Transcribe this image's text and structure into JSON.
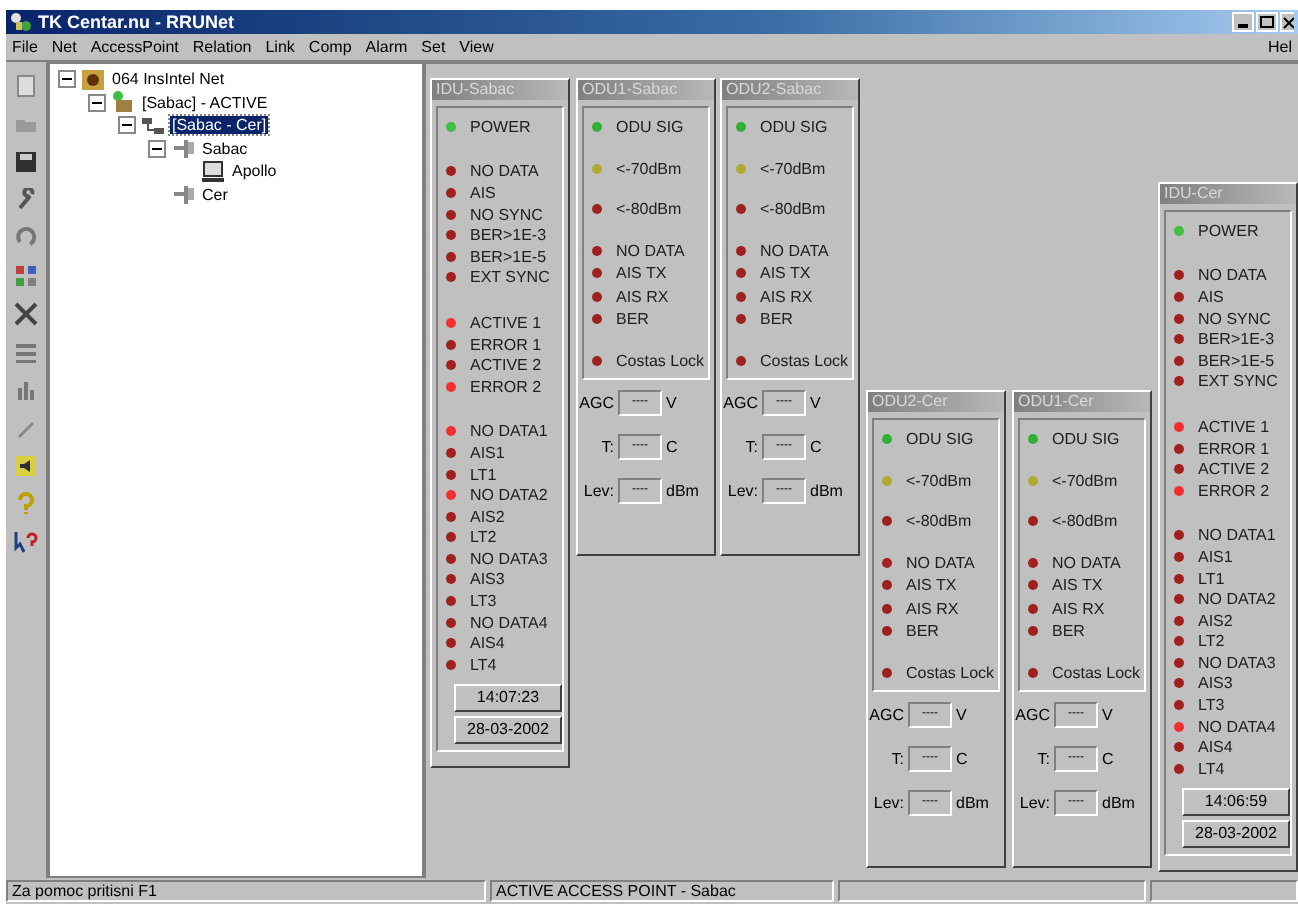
{
  "window": {
    "title": "TK Centar.nu - RRUNet"
  },
  "menu": [
    "File",
    "Net",
    "AccessPoint",
    "Relation",
    "Link",
    "Comp",
    "Alarm",
    "Set",
    "View"
  ],
  "help_menu": "Hel",
  "tree": [
    {
      "label": "064 InsIntel Net",
      "kind": "net",
      "selected": false,
      "expanded": true,
      "children": [
        {
          "label": "[Sabac] - ACTIVE",
          "kind": "access_point",
          "selected": false,
          "expanded": true,
          "children": [
            {
              "label": "[Sabac - Cer]",
              "kind": "relation",
              "selected": true,
              "expanded": true,
              "children": [
                {
                  "label": "Sabac",
                  "kind": "device",
                  "selected": false,
                  "expanded": true,
                  "children": [
                    {
                      "label": "Apollo",
                      "kind": "terminal",
                      "selected": false
                    }
                  ]
                },
                {
                  "label": "Cer",
                  "kind": "device",
                  "selected": false
                }
              ]
            }
          ]
        }
      ]
    }
  ],
  "panels": [
    {
      "kind": "idu",
      "title": "IDU-Sabac",
      "groups": [
        [
          {
            "label": "POWER",
            "color": "#40c040"
          }
        ],
        [
          {
            "label": "NO DATA",
            "color": "#a02020"
          },
          {
            "label": "AIS",
            "color": "#a02020"
          },
          {
            "label": "NO SYNC",
            "color": "#a02020"
          },
          {
            "label": "BER>1E-3",
            "color": "#a02020"
          },
          {
            "label": "BER>1E-5",
            "color": "#a02020"
          },
          {
            "label": "EXT SYNC",
            "color": "#a02020"
          }
        ],
        [
          {
            "label": "ACTIVE 1",
            "color": "#f03030"
          },
          {
            "label": "ERROR 1",
            "color": "#a02020"
          },
          {
            "label": "ACTIVE 2",
            "color": "#a02020"
          },
          {
            "label": "ERROR 2",
            "color": "#f03030"
          }
        ],
        [
          {
            "label": "NO DATA1",
            "color": "#f03030"
          },
          {
            "label": "AIS1",
            "color": "#a02020"
          },
          {
            "label": "LT1",
            "color": "#a02020"
          },
          {
            "label": "NO DATA2",
            "color": "#f03030"
          },
          {
            "label": "AIS2",
            "color": "#a02020"
          },
          {
            "label": "LT2",
            "color": "#a02020"
          },
          {
            "label": "NO DATA3",
            "color": "#a02020"
          },
          {
            "label": "AIS3",
            "color": "#a02020"
          },
          {
            "label": "LT3",
            "color": "#a02020"
          },
          {
            "label": "NO DATA4",
            "color": "#a02020"
          },
          {
            "label": "AIS4",
            "color": "#a02020"
          },
          {
            "label": "LT4",
            "color": "#a02020"
          }
        ]
      ],
      "time": "14:07:23",
      "date": "28-03-2002"
    },
    {
      "kind": "odu",
      "title": "ODU1-Sabac",
      "groups": [
        [
          {
            "label": "ODU SIG",
            "color": "#30b030"
          }
        ],
        [
          {
            "label": "<-70dBm",
            "color": "#b0a830"
          }
        ],
        [
          {
            "label": "<-80dBm",
            "color": "#a02020"
          }
        ],
        [
          {
            "label": "NO DATA",
            "color": "#a02020"
          },
          {
            "label": "AIS TX",
            "color": "#a02020"
          },
          {
            "label": "AIS RX",
            "color": "#a02020"
          },
          {
            "label": "BER",
            "color": "#a02020"
          }
        ],
        [
          {
            "label": "Costas Lock",
            "color": "#a02020"
          }
        ]
      ],
      "fields": [
        {
          "label": "AGC",
          "value": "----",
          "unit": "V"
        },
        {
          "label": "T:",
          "value": "----",
          "unit": "C"
        },
        {
          "label": "Lev:",
          "value": "----",
          "unit": "dBm"
        }
      ]
    },
    {
      "kind": "odu",
      "title": "ODU2-Sabac",
      "groups": [
        [
          {
            "label": "ODU SIG",
            "color": "#30b030"
          }
        ],
        [
          {
            "label": "<-70dBm",
            "color": "#b0a830"
          }
        ],
        [
          {
            "label": "<-80dBm",
            "color": "#a02020"
          }
        ],
        [
          {
            "label": "NO DATA",
            "color": "#a02020"
          },
          {
            "label": "AIS TX",
            "color": "#a02020"
          },
          {
            "label": "AIS RX",
            "color": "#a02020"
          },
          {
            "label": "BER",
            "color": "#a02020"
          }
        ],
        [
          {
            "label": "Costas Lock",
            "color": "#a02020"
          }
        ]
      ],
      "fields": [
        {
          "label": "AGC",
          "value": "----",
          "unit": "V"
        },
        {
          "label": "T:",
          "value": "----",
          "unit": "C"
        },
        {
          "label": "Lev:",
          "value": "----",
          "unit": "dBm"
        }
      ]
    },
    {
      "kind": "odu",
      "title": "ODU2-Cer",
      "groups": [
        [
          {
            "label": "ODU SIG",
            "color": "#30b030"
          }
        ],
        [
          {
            "label": "<-70dBm",
            "color": "#b0a830"
          }
        ],
        [
          {
            "label": "<-80dBm",
            "color": "#a02020"
          }
        ],
        [
          {
            "label": "NO DATA",
            "color": "#a02020"
          },
          {
            "label": "AIS TX",
            "color": "#a02020"
          },
          {
            "label": "AIS RX",
            "color": "#a02020"
          },
          {
            "label": "BER",
            "color": "#a02020"
          }
        ],
        [
          {
            "label": "Costas Lock",
            "color": "#a02020"
          }
        ]
      ],
      "fields": [
        {
          "label": "AGC",
          "value": "----",
          "unit": "V"
        },
        {
          "label": "T:",
          "value": "----",
          "unit": "C"
        },
        {
          "label": "Lev:",
          "value": "----",
          "unit": "dBm"
        }
      ]
    },
    {
      "kind": "odu",
      "title": "ODU1-Cer",
      "groups": [
        [
          {
            "label": "ODU SIG",
            "color": "#30b030"
          }
        ],
        [
          {
            "label": "<-70dBm",
            "color": "#b0a830"
          }
        ],
        [
          {
            "label": "<-80dBm",
            "color": "#a02020"
          }
        ],
        [
          {
            "label": "NO DATA",
            "color": "#a02020"
          },
          {
            "label": "AIS TX",
            "color": "#a02020"
          },
          {
            "label": "AIS RX",
            "color": "#a02020"
          },
          {
            "label": "BER",
            "color": "#a02020"
          }
        ],
        [
          {
            "label": "Costas Lock",
            "color": "#a02020"
          }
        ]
      ],
      "fields": [
        {
          "label": "AGC",
          "value": "----",
          "unit": "V"
        },
        {
          "label": "T:",
          "value": "----",
          "unit": "C"
        },
        {
          "label": "Lev:",
          "value": "----",
          "unit": "dBm"
        }
      ]
    },
    {
      "kind": "idu",
      "title": "IDU-Cer",
      "groups": [
        [
          {
            "label": "POWER",
            "color": "#40c040"
          }
        ],
        [
          {
            "label": "NO DATA",
            "color": "#a02020"
          },
          {
            "label": "AIS",
            "color": "#a02020"
          },
          {
            "label": "NO SYNC",
            "color": "#a02020"
          },
          {
            "label": "BER>1E-3",
            "color": "#a02020"
          },
          {
            "label": "BER>1E-5",
            "color": "#a02020"
          },
          {
            "label": "EXT SYNC",
            "color": "#a02020"
          }
        ],
        [
          {
            "label": "ACTIVE 1",
            "color": "#f03030"
          },
          {
            "label": "ERROR 1",
            "color": "#a02020"
          },
          {
            "label": "ACTIVE 2",
            "color": "#a02020"
          },
          {
            "label": "ERROR 2",
            "color": "#f03030"
          }
        ],
        [
          {
            "label": "NO DATA1",
            "color": "#a02020"
          },
          {
            "label": "AIS1",
            "color": "#a02020"
          },
          {
            "label": "LT1",
            "color": "#a02020"
          },
          {
            "label": "NO DATA2",
            "color": "#a02020"
          },
          {
            "label": "AIS2",
            "color": "#a02020"
          },
          {
            "label": "LT2",
            "color": "#a02020"
          },
          {
            "label": "NO DATA3",
            "color": "#a02020"
          },
          {
            "label": "AIS3",
            "color": "#a02020"
          },
          {
            "label": "LT3",
            "color": "#a02020"
          },
          {
            "label": "NO DATA4",
            "color": "#f03030"
          },
          {
            "label": "AIS4",
            "color": "#a02020"
          },
          {
            "label": "LT4",
            "color": "#a02020"
          }
        ]
      ],
      "time": "14:06:59",
      "date": "28-03-2002"
    }
  ],
  "status_bar": [
    "Za pomoc pritisni F1",
    "ACTIVE ACCESS POINT - Sabac"
  ]
}
